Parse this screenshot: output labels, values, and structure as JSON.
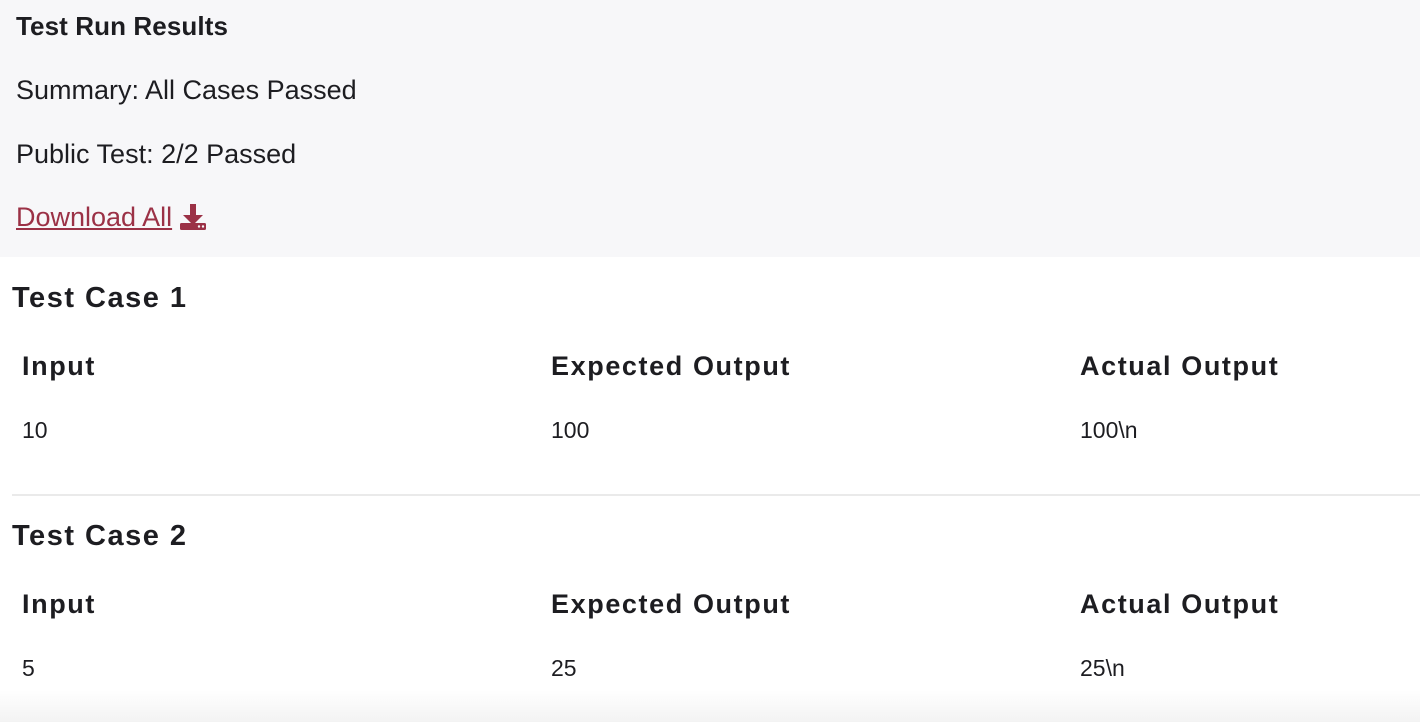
{
  "summary": {
    "title": "Test Run Results",
    "summary_text": "Summary: All Cases Passed",
    "public_test_text": "Public Test: 2/2 Passed",
    "download_label": "Download All",
    "download_icon": "download-icon"
  },
  "columns": {
    "input": "Input",
    "expected": "Expected Output",
    "actual": "Actual Output"
  },
  "test_cases": [
    {
      "title": "Test Case 1",
      "input": "10",
      "expected": "100",
      "actual": "100\\n"
    },
    {
      "title": "Test Case 2",
      "input": "5",
      "expected": "25",
      "actual": "25\\n"
    }
  ],
  "colors": {
    "link": "#9b3146",
    "panel_bg": "#f7f7f9",
    "text": "#1d1d21"
  }
}
